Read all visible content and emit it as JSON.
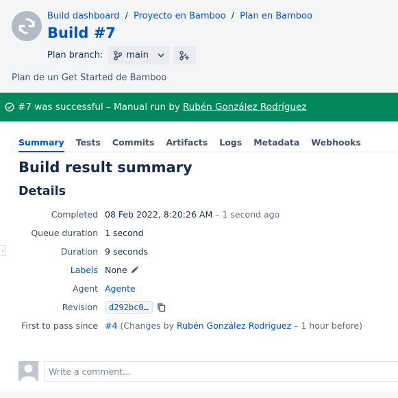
{
  "breadcrumb": [
    "Build dashboard",
    "Proyecto en Bamboo",
    "Plan en Bamboo"
  ],
  "build": {
    "title": "Build #7"
  },
  "branch": {
    "label": "Plan branch:",
    "selected": "main"
  },
  "plan_description": "Plan de un Get Started de Bamboo",
  "status": {
    "text": "#7 was successful – Manual run by",
    "user": "Rubén González Rodríguez",
    "color": "#00875a"
  },
  "tabs": [
    "Summary",
    "Tests",
    "Commits",
    "Artifacts",
    "Logs",
    "Metadata",
    "Webhooks"
  ],
  "active_tab": "Summary",
  "heading": "Build result summary",
  "subheading": "Details",
  "details": {
    "completed": {
      "label": "Completed",
      "value": "08 Feb 2022, 8:20:26 AM",
      "relative": "– 1 second ago"
    },
    "queue": {
      "label": "Queue duration",
      "value": "1 second"
    },
    "duration": {
      "label": "Duration",
      "value": "9 seconds"
    },
    "labels": {
      "label": "Labels",
      "value": "None"
    },
    "agent": {
      "label": "Agent",
      "value": "Agente"
    },
    "revision": {
      "label": "Revision",
      "value": "d292bc0…"
    },
    "first_pass": {
      "label": "First to pass since",
      "build": "#4",
      "prefix": "(Changes by",
      "user": "Rubén González Rodríguez",
      "suffix": "– 1 hour before)"
    }
  },
  "comment": {
    "placeholder": "Write a comment..."
  },
  "colors": {
    "accent": "#0052cc",
    "success": "#00875a",
    "text": "#172b4d"
  }
}
